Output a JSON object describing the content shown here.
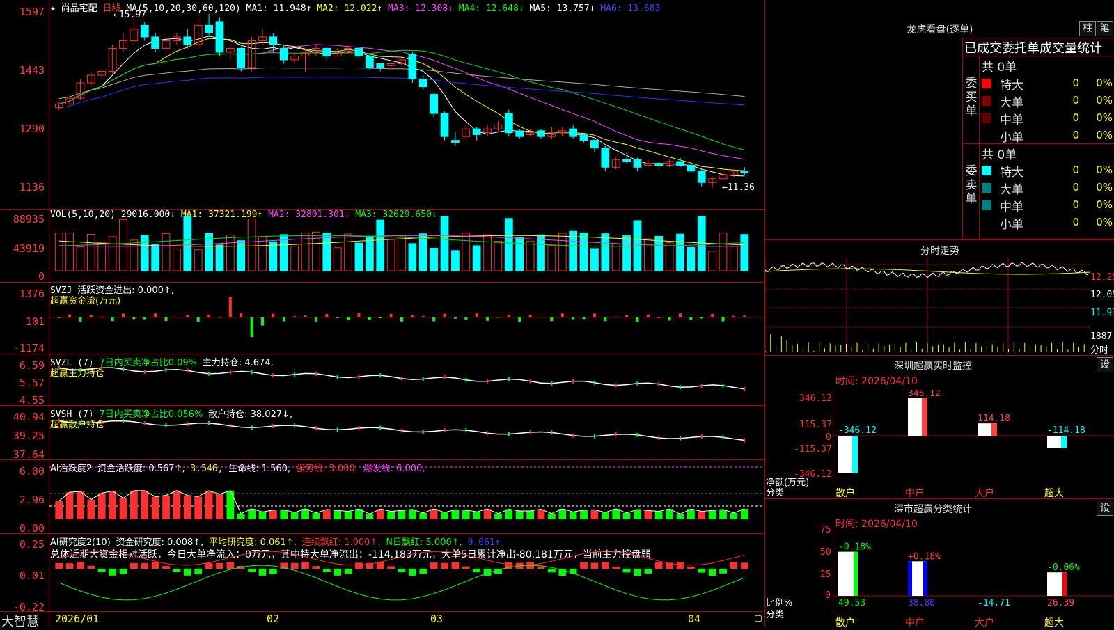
{
  "header": {
    "star": "★",
    "stock_name": "尚品宅配",
    "period": "日线",
    "ma_def": "MA(5,10,20,30,60,120)",
    "ma1": "MA1: 11.948↑",
    "ma2": "MA2: 12.022↑",
    "ma3": "MA3: 12.308↓",
    "ma4": "MA4: 12.648↓",
    "ma5": "MA5: 13.757↓",
    "ma6": "MA6: 13.683",
    "high_marker": "15.97",
    "low_marker": "11.36"
  },
  "price_axis": [
    "1597",
    "1443",
    "1290",
    "1136"
  ],
  "vol_header": {
    "def": "VOL(5,10,20)",
    "val": "29016.000↓",
    "ma1": "MA1: 37321.199↑",
    "ma2": "MA2: 32801.301↓",
    "ma3": "MA3: 32629.650↓"
  },
  "vol_axis": [
    "88935",
    "43919",
    "0"
  ],
  "svzj": {
    "def": "SVZJ",
    "txt1": "活跃资金进出: 0.000↑,",
    "txt2": "超赢资金流(万元)",
    "axis": [
      "1376",
      "101",
      "-1174"
    ]
  },
  "svzl": {
    "def": "SVZL (7)",
    "txt1": "7日内买卖净占比0.09%",
    "txt2": "主力持仓: 4.674,",
    "txt3": "超赢主力持仓",
    "axis": [
      "6.59",
      "5.57",
      "4.55"
    ]
  },
  "svsh": {
    "def": "SVSH (7)",
    "txt1": "7日内买卖净占比0.056%",
    "txt2": "散户持仓: 38.027↓,",
    "txt3": "超赢散户持仓",
    "axis": [
      "40.94",
      "39.25",
      "37.64"
    ]
  },
  "ai1": {
    "def": "AI活跃度2",
    "txt1": "资金活跃度: 0.567↑,",
    "txt2": "3.546,",
    "txt3": "生命线: 1.560,",
    "txt4": "强势线: 3.000,",
    "txt5": "爆发线: 6.000,",
    "axis": [
      "6.00",
      "2.96",
      "0.00"
    ]
  },
  "ai2": {
    "def": "AI研究度2(10)",
    "txt1": "资金研究度: 0.008↑,",
    "txt2": "平均研究度: 0.061↑,",
    "txt3": "连续飘红: 1.000↑,",
    "txt4": "N日飘红: 5.000↑,",
    "txt5": "0.061↑",
    "summary": "总体近期大资金相对活跃，今日大单净流入：0万元，其中特大单净流出：-114.183万元，大单5日累计净出-80.181万元，当前主力控盘弱",
    "axis": [
      "0.25",
      "0.01",
      "-0.22"
    ]
  },
  "date_axis": [
    "2026/01",
    "02",
    "03",
    "04"
  ],
  "brand": "大智慧",
  "right": {
    "title": "龙虎看盘(逐单)",
    "btn_bar": "柱",
    "btn_pen": "笔",
    "stat_title": "已成交委托单成交量统计",
    "buy_label": "委买单",
    "sell_label": "委卖单",
    "buy_total": "共 0单",
    "sell_total": "共 0单",
    "buy_rows": [
      {
        "label": "特大",
        "num": "0",
        "pct": "0%"
      },
      {
        "label": "大单",
        "num": "0",
        "pct": "0%"
      },
      {
        "label": "中单",
        "num": "0",
        "pct": "0%"
      },
      {
        "label": "小单",
        "num": "0",
        "pct": "0%"
      }
    ],
    "sell_rows": [
      {
        "label": "特大",
        "num": "0",
        "pct": "0%"
      },
      {
        "label": "大单",
        "num": "0",
        "pct": "0%"
      },
      {
        "label": "中单",
        "num": "0",
        "pct": "0%"
      },
      {
        "label": "小单",
        "num": "0",
        "pct": "0%"
      }
    ],
    "intraday_title": "分时走势",
    "intraday_axis": [
      "12.25",
      "12.09",
      "11.93"
    ],
    "intraday_vol": "1887",
    "intraday_vol_label": "分时",
    "sz_title": "深圳超赢实时监控",
    "sz_btn": "设",
    "sz_time": "时间: 2026/04/10",
    "sz_axis": [
      "346.12",
      "115.37",
      "0",
      "-115.37",
      "-346.12"
    ],
    "sz_ylabel": "净额(万元)",
    "sz_xlabel": "分类",
    "sz_bars": [
      {
        "cat": "散户",
        "top": "",
        "bot": "-346.12",
        "val": -346.12
      },
      {
        "cat": "中户",
        "top": "346.12",
        "bot": "",
        "val": 346.12
      },
      {
        "cat": "大户",
        "top": "114.18",
        "bot": "",
        "val": 114.18
      },
      {
        "cat": "超大",
        "top": "",
        "bot": "-114.18",
        "val": -114.18
      }
    ],
    "sm_title": "深市超赢分类统计",
    "sm_btn": "设",
    "sm_time": "时间: 2026/04/10",
    "sm_axis": [
      "75",
      "50",
      "25",
      "0"
    ],
    "sm_ylabel": "比例%",
    "sm_xlabel": "分类",
    "sm_bars": [
      {
        "cat": "散户",
        "top": "-0.18%",
        "bot": "49.53",
        "val": 49.53
      },
      {
        "cat": "中户",
        "top": "+0.18%",
        "bot": "38.80",
        "val": 38.8
      },
      {
        "cat": "大户",
        "top": "",
        "bot": "-14.71",
        "val": 0
      },
      {
        "cat": "超大",
        "top": "-0.06%",
        "bot": "26.39",
        "val": 26.39
      }
    ]
  },
  "colors": {
    "up": "#ff3030",
    "down": "#00ffff",
    "ma1": "#ffffff",
    "ma2": "#ffff00",
    "ma3": "#ff40ff",
    "ma4": "#00e000",
    "ma5": "#aaaaaa",
    "ma6": "#3030ff"
  },
  "chart_data": {
    "type": "candlestick",
    "price_ylim": [
      11.36,
      15.97
    ],
    "candles": [
      [
        13.45,
        13.55,
        13.6,
        13.4
      ],
      [
        13.55,
        13.7,
        13.8,
        13.5
      ],
      [
        13.7,
        14.1,
        14.2,
        13.65
      ],
      [
        14.1,
        14.3,
        14.4,
        14.0
      ],
      [
        14.3,
        14.4,
        14.5,
        14.2
      ],
      [
        14.4,
        15.0,
        15.1,
        14.35
      ],
      [
        15.0,
        15.2,
        15.4,
        14.9
      ],
      [
        15.2,
        15.5,
        15.97,
        15.1
      ],
      [
        15.6,
        15.3,
        15.7,
        15.2
      ],
      [
        15.3,
        15.0,
        15.4,
        14.9
      ],
      [
        15.0,
        15.2,
        15.3,
        14.8
      ],
      [
        15.2,
        15.3,
        15.4,
        15.1
      ],
      [
        15.3,
        15.1,
        15.5,
        15.0
      ],
      [
        15.1,
        15.6,
        15.8,
        15.0
      ],
      [
        15.6,
        15.4,
        15.9,
        15.3
      ],
      [
        15.7,
        14.9,
        15.8,
        14.8
      ],
      [
        14.9,
        15.0,
        15.1,
        14.7
      ],
      [
        15.0,
        14.5,
        15.05,
        14.4
      ],
      [
        14.5,
        15.2,
        15.3,
        14.4
      ],
      [
        15.2,
        15.3,
        15.5,
        15.1
      ],
      [
        15.3,
        15.1,
        15.4,
        14.9
      ],
      [
        15.0,
        14.7,
        15.1,
        14.6
      ],
      [
        14.7,
        14.8,
        14.9,
        14.6
      ],
      [
        14.8,
        14.9,
        15.0,
        14.4
      ],
      [
        14.9,
        15.0,
        15.1,
        14.8
      ],
      [
        15.0,
        14.8,
        15.05,
        14.7
      ],
      [
        14.8,
        14.9,
        15.0,
        14.8
      ],
      [
        14.9,
        15.0,
        15.1,
        14.85
      ],
      [
        15.0,
        14.8,
        15.05,
        14.75
      ],
      [
        14.8,
        14.5,
        14.85,
        14.45
      ],
      [
        14.6,
        14.5,
        14.6,
        14.4
      ],
      [
        14.55,
        14.6,
        14.65,
        14.45
      ],
      [
        14.6,
        14.7,
        14.75,
        14.55
      ],
      [
        14.85,
        14.2,
        14.9,
        14.1
      ],
      [
        14.2,
        14.0,
        14.3,
        13.9
      ],
      [
        13.8,
        13.3,
        13.85,
        13.2
      ],
      [
        13.3,
        12.7,
        13.35,
        12.6
      ],
      [
        12.6,
        12.55,
        12.8,
        12.45
      ],
      [
        12.7,
        12.9,
        13.0,
        12.6
      ],
      [
        12.9,
        12.75,
        12.95,
        12.6
      ],
      [
        12.8,
        12.9,
        13.0,
        12.7
      ],
      [
        12.9,
        13.0,
        13.1,
        12.85
      ],
      [
        13.3,
        12.8,
        13.4,
        12.7
      ],
      [
        12.85,
        12.7,
        12.9,
        12.65
      ],
      [
        12.75,
        12.8,
        12.9,
        12.7
      ],
      [
        12.85,
        12.7,
        12.9,
        12.65
      ],
      [
        12.7,
        12.8,
        12.95,
        12.65
      ],
      [
        12.8,
        12.85,
        12.95,
        12.7
      ],
      [
        12.9,
        12.7,
        13.0,
        12.65
      ],
      [
        12.75,
        12.6,
        12.8,
        12.55
      ],
      [
        12.6,
        12.4,
        12.65,
        12.3
      ],
      [
        12.4,
        11.9,
        12.45,
        11.8
      ],
      [
        11.9,
        12.1,
        12.15,
        11.85
      ],
      [
        12.1,
        12.05,
        12.3,
        12.0
      ],
      [
        12.1,
        11.9,
        12.15,
        11.8
      ],
      [
        11.95,
        12.0,
        12.1,
        11.9
      ],
      [
        12.0,
        11.95,
        12.05,
        11.85
      ],
      [
        11.95,
        12.05,
        12.1,
        11.9
      ],
      [
        12.05,
        11.95,
        12.15,
        11.9
      ],
      [
        11.95,
        11.8,
        12.0,
        11.75
      ],
      [
        11.8,
        11.5,
        11.85,
        11.4
      ],
      [
        11.5,
        11.6,
        11.65,
        11.36
      ],
      [
        11.6,
        11.7,
        11.8,
        11.55
      ],
      [
        11.7,
        11.8,
        11.85,
        11.65
      ],
      [
        11.8,
        11.75,
        11.9,
        11.7
      ]
    ]
  }
}
